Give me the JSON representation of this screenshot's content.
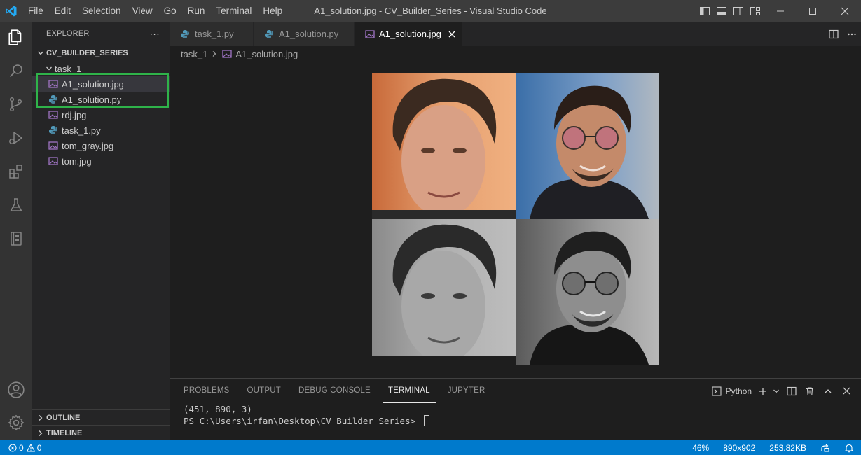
{
  "window": {
    "title": "A1_solution.jpg - CV_Builder_Series - Visual Studio Code"
  },
  "menu": [
    "File",
    "Edit",
    "Selection",
    "View",
    "Go",
    "Run",
    "Terminal",
    "Help"
  ],
  "activity_bar": {
    "top": [
      "explorer-icon",
      "search-icon",
      "source-control-icon",
      "run-debug-icon",
      "extensions-icon",
      "testing-icon",
      "notebook-icon"
    ],
    "bottom": [
      "account-icon",
      "settings-gear-icon"
    ]
  },
  "sidebar": {
    "header": "EXPLORER",
    "more": "···",
    "root": "CV_BUILDER_SERIES",
    "folder": "task_1",
    "files": [
      {
        "name": "A1_solution.jpg",
        "type": "image",
        "indent": 2
      },
      {
        "name": "A1_solution.py",
        "type": "python",
        "indent": 2
      },
      {
        "name": "rdj.jpg",
        "type": "image",
        "indent": 1
      },
      {
        "name": "task_1.py",
        "type": "python",
        "indent": 1
      },
      {
        "name": "tom_gray.jpg",
        "type": "image",
        "indent": 1
      },
      {
        "name": "tom.jpg",
        "type": "image",
        "indent": 1
      }
    ],
    "outline": "OUTLINE",
    "timeline": "TIMELINE"
  },
  "tabs": [
    {
      "label": "task_1.py",
      "type": "python",
      "active": false
    },
    {
      "label": "A1_solution.py",
      "type": "python",
      "active": false
    },
    {
      "label": "A1_solution.jpg",
      "type": "image",
      "active": true
    }
  ],
  "breadcrumb": {
    "folder": "task_1",
    "file": "A1_solution.jpg"
  },
  "panel": {
    "tabs": [
      "PROBLEMS",
      "OUTPUT",
      "DEBUG CONSOLE",
      "TERMINAL",
      "JUPYTER"
    ],
    "active_tab": "TERMINAL",
    "shell": "Python",
    "terminal_lines": [
      "(451, 890, 3)",
      "PS C:\\Users\\irfan\\Desktop\\CV_Builder_Series> "
    ]
  },
  "status": {
    "errors": "0",
    "warnings": "0",
    "zoom": "46%",
    "dimensions": "890x902",
    "size": "253.82KB"
  },
  "colors": {
    "accent": "#007acc",
    "highlight": "#2fb34a",
    "python_icon": "#519aba",
    "image_icon": "#a074c4"
  }
}
